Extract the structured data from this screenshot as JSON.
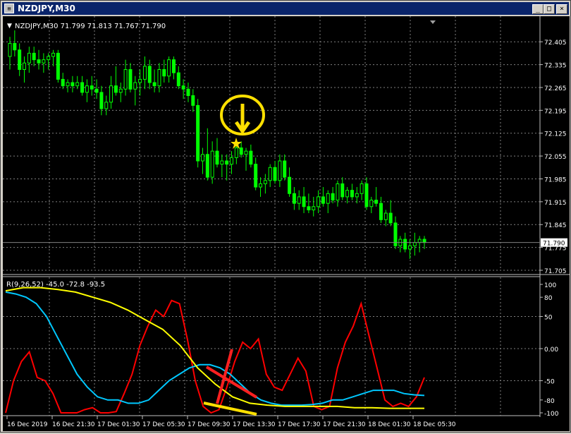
{
  "window": {
    "title": "NZDJPY,M30",
    "icon": "chart-window-icon",
    "buttons": {
      "minimize": "_",
      "maximize": "□",
      "close": "×"
    }
  },
  "chart_header": {
    "marker": "▼",
    "text": "NZDJPY,M30  71.799 71.813 71.767 71.790"
  },
  "price_axis": {
    "ticks": [
      "72.405",
      "72.335",
      "72.265",
      "72.195",
      "72.125",
      "72.055",
      "71.985",
      "71.915",
      "71.845",
      "71.775",
      "71.705"
    ],
    "current_price": "71.790"
  },
  "indicator": {
    "label": "R(9,26,52) -45.0 -72.8 -93.5",
    "ticks": [
      "100",
      "80",
      "50",
      "0.00",
      "-50",
      "-80",
      "-100"
    ]
  },
  "time_axis": {
    "ticks": [
      "16 Dec 2019",
      "16 Dec 21:30",
      "17 Dec 01:30",
      "17 Dec 05:30",
      "17 Dec 09:30",
      "17 Dec 13:30",
      "17 Dec 17:30",
      "17 Dec 21:30",
      "18 Dec 01:30",
      "18 Dec 05:30"
    ]
  },
  "colors": {
    "background": "#000000",
    "grid": "#808080",
    "candle": "#00ff00",
    "ind_fast": "#ff0000",
    "ind_mid": "#00c8ff",
    "ind_slow": "#ffff00",
    "annotation": "#ffe000",
    "cross": "#ff2020"
  },
  "chart_data": [
    {
      "type": "candlestick",
      "symbol": "NZDJPY",
      "timeframe": "M30",
      "ylim": [
        71.705,
        72.44
      ],
      "candles": [
        [
          72.36,
          72.42,
          72.32,
          72.4
        ],
        [
          72.4,
          72.44,
          72.36,
          72.38
        ],
        [
          72.38,
          72.4,
          72.3,
          72.32
        ],
        [
          72.32,
          72.36,
          72.28,
          72.34
        ],
        [
          72.34,
          72.39,
          72.31,
          72.37
        ],
        [
          72.37,
          72.39,
          72.33,
          72.35
        ],
        [
          72.35,
          72.38,
          72.32,
          72.34
        ],
        [
          72.34,
          72.37,
          72.31,
          72.35
        ],
        [
          72.35,
          72.37,
          72.32,
          72.36
        ],
        [
          72.36,
          72.38,
          72.33,
          72.37
        ],
        [
          72.37,
          72.38,
          72.28,
          72.29
        ],
        [
          72.29,
          72.31,
          72.26,
          72.27
        ],
        [
          72.27,
          72.29,
          72.25,
          72.28
        ],
        [
          72.28,
          72.3,
          72.25,
          72.27
        ],
        [
          72.27,
          72.3,
          72.26,
          72.28
        ],
        [
          72.28,
          72.3,
          72.24,
          72.25
        ],
        [
          72.25,
          72.29,
          72.22,
          72.27
        ],
        [
          72.27,
          72.3,
          72.24,
          72.26
        ],
        [
          72.26,
          72.29,
          72.23,
          72.25
        ],
        [
          72.25,
          72.27,
          72.18,
          72.2
        ],
        [
          72.2,
          72.24,
          72.18,
          72.22
        ],
        [
          72.22,
          72.3,
          72.2,
          72.27
        ],
        [
          72.27,
          72.33,
          72.24,
          72.25
        ],
        [
          72.25,
          72.28,
          72.22,
          72.26
        ],
        [
          72.26,
          72.35,
          72.24,
          72.32
        ],
        [
          72.32,
          72.34,
          72.25,
          72.26
        ],
        [
          72.26,
          72.3,
          72.21,
          72.28
        ],
        [
          72.28,
          72.32,
          72.24,
          72.29
        ],
        [
          72.29,
          72.36,
          72.26,
          72.33
        ],
        [
          72.33,
          72.35,
          72.26,
          72.28
        ],
        [
          72.28,
          72.32,
          72.25,
          72.27
        ],
        [
          72.27,
          72.34,
          72.25,
          72.32
        ],
        [
          72.32,
          72.35,
          72.28,
          72.3
        ],
        [
          72.3,
          72.36,
          72.28,
          72.35
        ],
        [
          72.35,
          72.36,
          72.29,
          72.31
        ],
        [
          72.31,
          72.33,
          72.26,
          72.27
        ],
        [
          72.27,
          72.29,
          72.23,
          72.26
        ],
        [
          72.26,
          72.28,
          72.22,
          72.24
        ],
        [
          72.24,
          72.26,
          72.19,
          72.21
        ],
        [
          72.21,
          72.23,
          72.02,
          72.04
        ],
        [
          72.04,
          72.08,
          72.0,
          72.06
        ],
        [
          72.06,
          72.14,
          71.98,
          71.99
        ],
        [
          71.99,
          72.1,
          71.97,
          72.07
        ],
        [
          72.07,
          72.11,
          72.02,
          72.03
        ],
        [
          72.03,
          72.06,
          71.99,
          72.04
        ],
        [
          72.04,
          72.06,
          71.98,
          72.03
        ],
        [
          72.03,
          72.07,
          72.0,
          72.05
        ],
        [
          72.05,
          72.09,
          72.03,
          72.08
        ],
        [
          72.08,
          72.1,
          72.05,
          72.06
        ],
        [
          72.06,
          72.08,
          72.01,
          72.07
        ],
        [
          72.07,
          72.09,
          72.02,
          72.03
        ],
        [
          72.03,
          72.05,
          71.95,
          71.96
        ],
        [
          71.96,
          71.99,
          71.93,
          71.97
        ],
        [
          71.97,
          72.0,
          71.94,
          71.98
        ],
        [
          71.98,
          72.03,
          71.96,
          72.02
        ],
        [
          72.02,
          72.04,
          71.97,
          71.98
        ],
        [
          71.98,
          72.06,
          71.96,
          72.04
        ],
        [
          72.04,
          72.06,
          71.98,
          71.99
        ],
        [
          71.99,
          72.02,
          71.93,
          71.94
        ],
        [
          71.94,
          71.96,
          71.89,
          71.91
        ],
        [
          71.91,
          71.95,
          71.89,
          71.93
        ],
        [
          71.93,
          71.96,
          71.88,
          71.9
        ],
        [
          71.9,
          71.94,
          71.88,
          71.89
        ],
        [
          71.89,
          71.93,
          71.87,
          71.9
        ],
        [
          71.9,
          71.95,
          71.88,
          71.93
        ],
        [
          71.93,
          71.96,
          71.9,
          71.91
        ],
        [
          71.91,
          71.95,
          71.88,
          71.94
        ],
        [
          71.94,
          71.96,
          71.91,
          71.92
        ],
        [
          71.92,
          71.98,
          71.9,
          71.97
        ],
        [
          71.97,
          71.99,
          71.92,
          71.93
        ],
        [
          71.93,
          71.96,
          71.91,
          71.95
        ],
        [
          71.95,
          71.97,
          71.92,
          71.93
        ],
        [
          71.93,
          71.96,
          71.91,
          71.94
        ],
        [
          71.94,
          71.98,
          71.92,
          71.97
        ],
        [
          71.97,
          71.99,
          71.89,
          71.9
        ],
        [
          71.9,
          71.93,
          71.88,
          71.92
        ],
        [
          71.92,
          71.96,
          71.9,
          71.91
        ],
        [
          71.91,
          71.93,
          71.85,
          71.86
        ],
        [
          71.86,
          71.89,
          71.84,
          71.88
        ],
        [
          71.88,
          71.92,
          71.84,
          71.85
        ],
        [
          71.85,
          71.87,
          71.77,
          71.78
        ],
        [
          71.78,
          71.81,
          71.76,
          71.8
        ],
        [
          71.8,
          71.82,
          71.76,
          71.77
        ],
        [
          71.77,
          71.8,
          71.74,
          71.78
        ],
        [
          71.78,
          71.82,
          71.75,
          71.79
        ],
        [
          71.79,
          71.81,
          71.76,
          71.8
        ],
        [
          71.8,
          71.81,
          71.77,
          71.79
        ]
      ]
    },
    {
      "type": "line",
      "title": "R(9,26,52)",
      "ylim": [
        -100,
        100
      ],
      "x_span": 120,
      "series": [
        {
          "name": "R(9)",
          "color": "#ff0000",
          "values": [
            -100,
            -50,
            -20,
            -5,
            -45,
            -50,
            -70,
            -100,
            -100,
            -100,
            -95,
            -92,
            -100,
            -100,
            -98,
            -70,
            -40,
            5,
            35,
            60,
            50,
            75,
            70,
            15,
            -50,
            -90,
            -100,
            -95,
            -60,
            -20,
            10,
            0,
            15,
            -40,
            -60,
            -65,
            -40,
            -15,
            -35,
            -90,
            -95,
            -90,
            -30,
            10,
            35,
            70,
            20,
            -30,
            -80,
            -90,
            -85,
            -90,
            -75,
            -45
          ]
        },
        {
          "name": "R(26)",
          "color": "#00c8ff",
          "values": [
            88,
            85,
            80,
            70,
            50,
            20,
            -10,
            -40,
            -60,
            -75,
            -80,
            -80,
            -85,
            -85,
            -80,
            -65,
            -50,
            -40,
            -30,
            -25,
            -25,
            -30,
            -40,
            -55,
            -70,
            -80,
            -85,
            -88,
            -88,
            -88,
            -87,
            -85,
            -80,
            -80,
            -75,
            -70,
            -65,
            -65,
            -65,
            -70,
            -72,
            -73
          ]
        },
        {
          "name": "R(52)",
          "color": "#ffff00",
          "values": [
            90,
            95,
            95,
            92,
            88,
            80,
            72,
            60,
            45,
            30,
            5,
            -30,
            -55,
            -75,
            -85,
            -88,
            -90,
            -90,
            -90,
            -90,
            -92,
            -92,
            -93,
            -93,
            -93
          ]
        }
      ],
      "annotations": [
        "yellow circle with down arrow above candle",
        "yellow star below arrow",
        "red X over indicator",
        "yellow underline below indicator"
      ]
    }
  ]
}
